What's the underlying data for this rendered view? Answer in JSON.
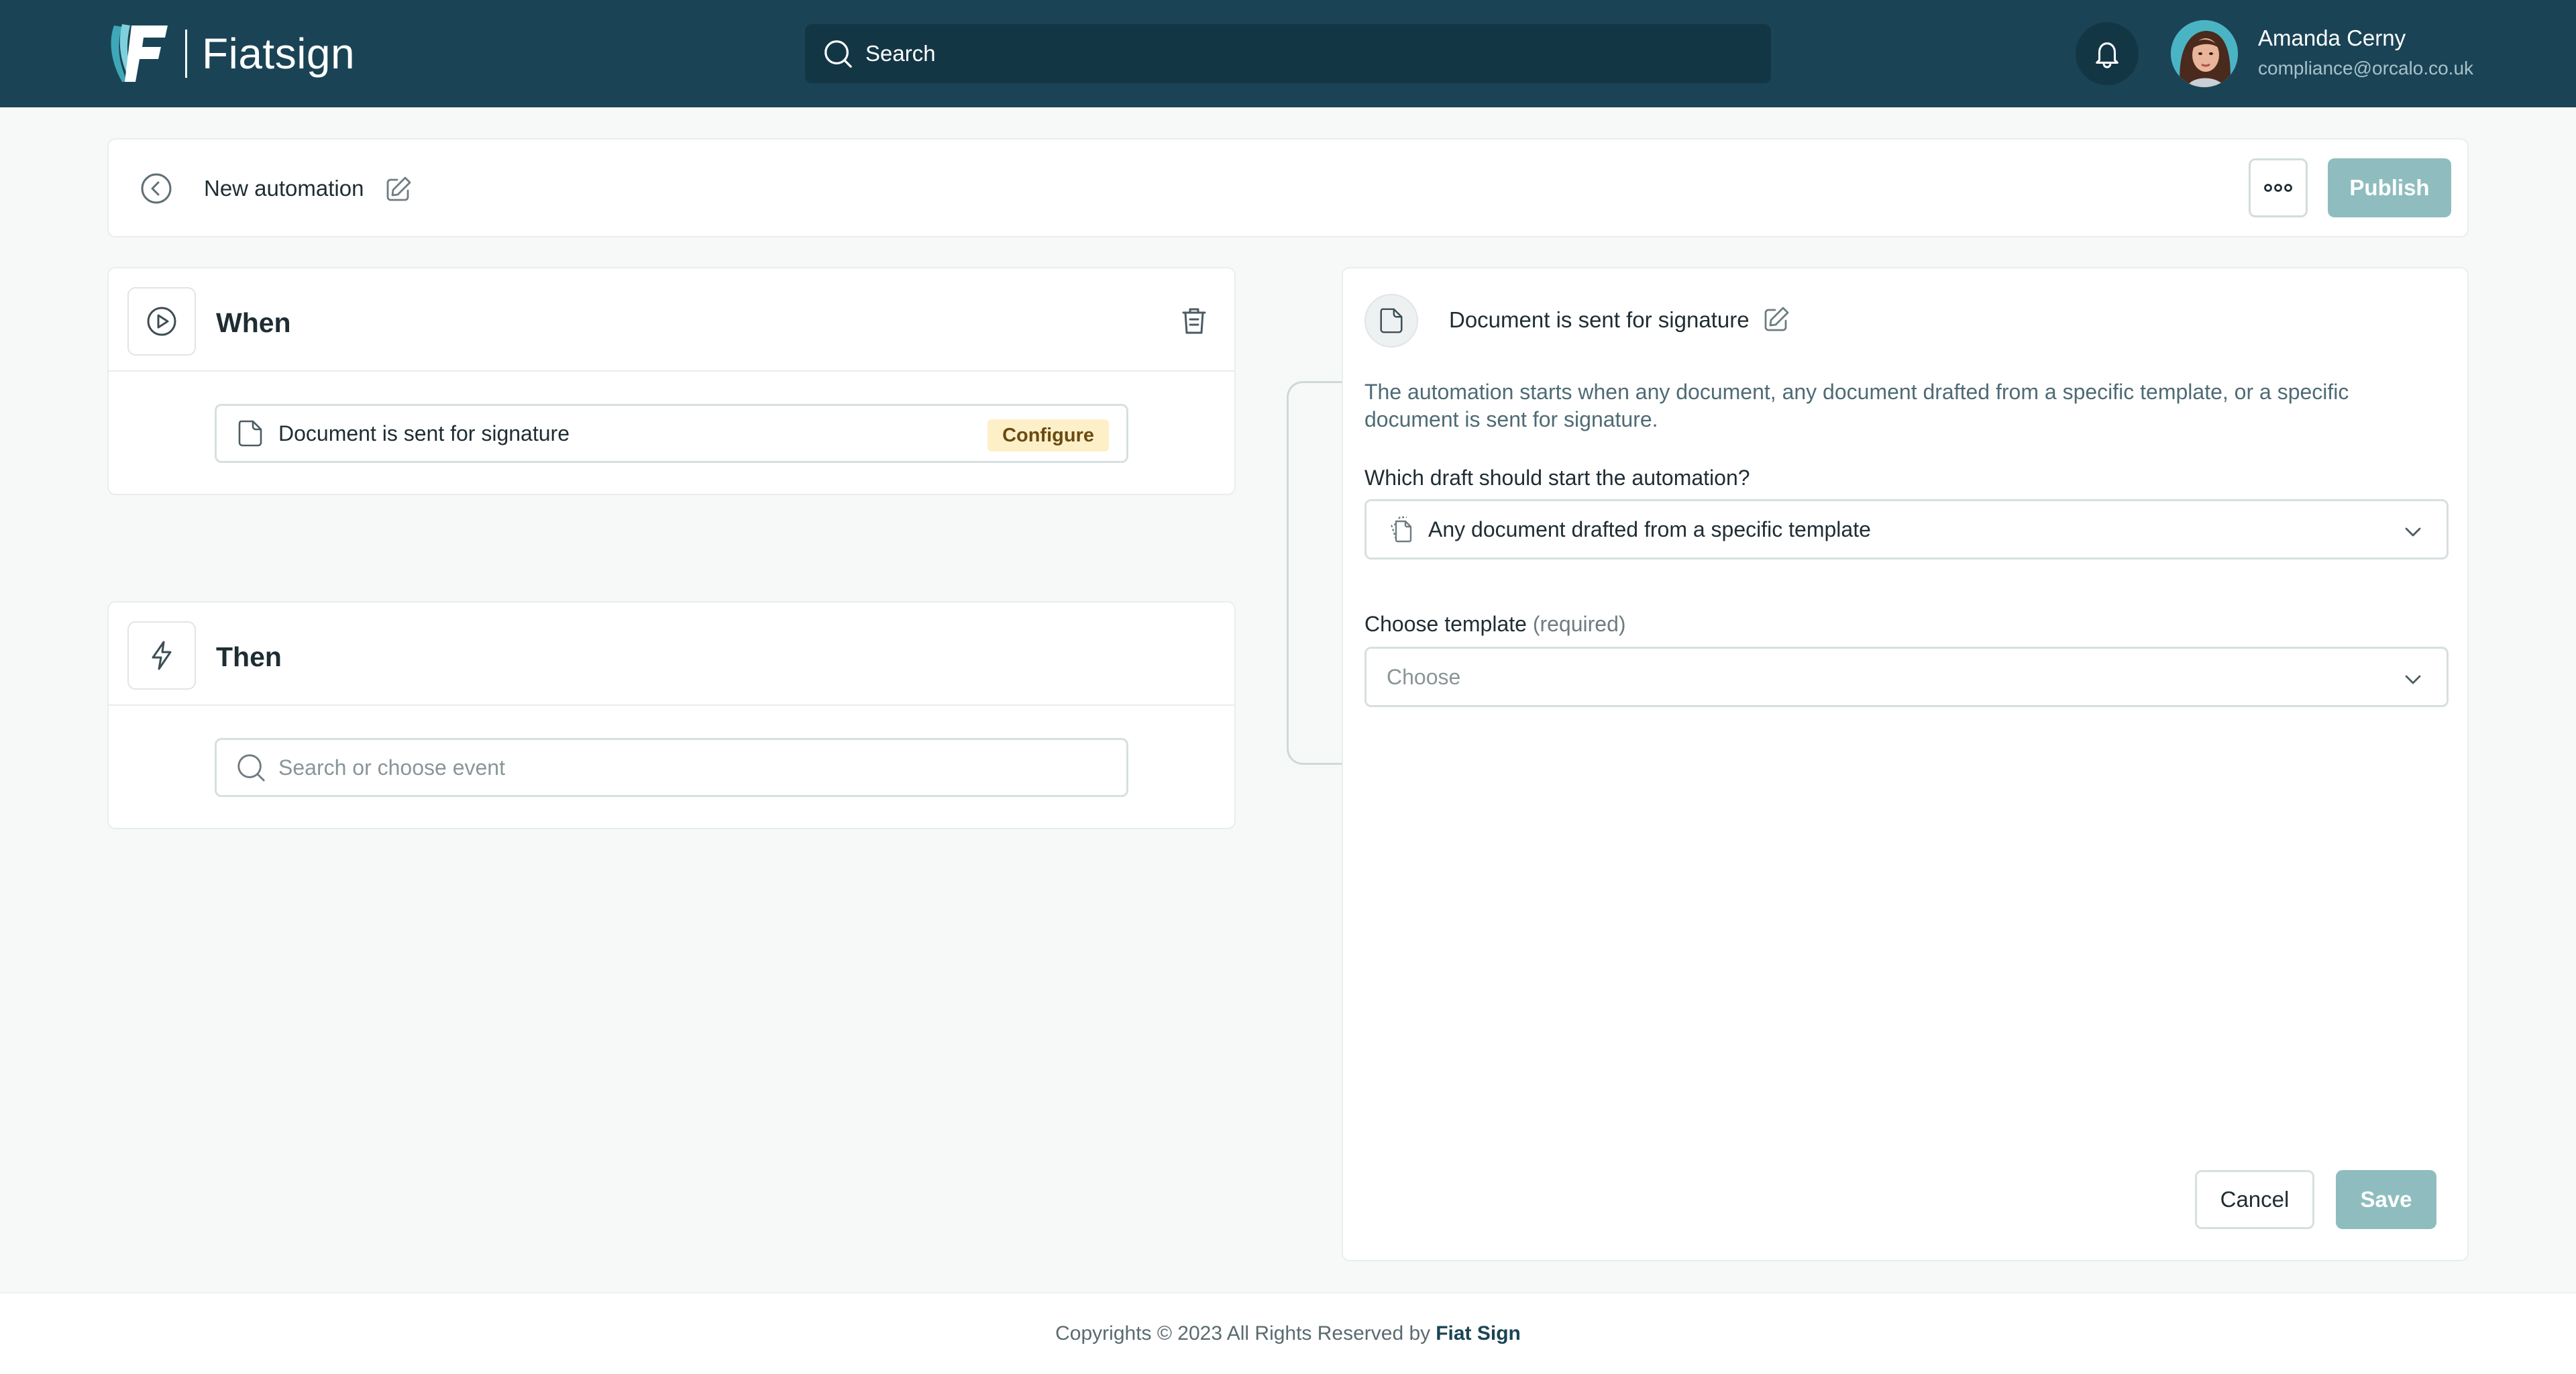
{
  "colors": {
    "header_bg": "#1a4455",
    "accent_teal": "#8fbdbf",
    "badge_bg": "#fdf0c8",
    "page_bg": "#f7f9f9"
  },
  "header": {
    "brand_name": "Fiatsign",
    "logo_icon": "fiatsign-logo",
    "search_placeholder": "Search",
    "notifications_icon": "bell-icon",
    "user": {
      "name": "Amanda Cerny",
      "email": "compliance@orcalo.co.uk"
    }
  },
  "automation_bar": {
    "title": "New automation",
    "back_icon": "back-arrow-icon",
    "edit_icon": "edit-icon",
    "more_icon": "more-dots-icon",
    "publish_label": "Publish"
  },
  "when_card": {
    "title": "When",
    "icon": "play-icon",
    "delete_icon": "trash-icon",
    "trigger": {
      "label": "Document is sent for signature",
      "badge": "Configure"
    }
  },
  "then_card": {
    "title": "Then",
    "icon": "lightning-icon",
    "event_placeholder": "Search or choose event"
  },
  "panel": {
    "title": "Document is sent for signature",
    "description": "The automation starts when any document, any document drafted from a specific template, or a specific document is sent for signature.",
    "draft_question": "Which draft should start the automation?",
    "draft_selected": "Any document drafted from a specific template",
    "template_label": "Choose template",
    "template_required": "(required)",
    "template_placeholder": "Choose",
    "cancel_label": "Cancel",
    "save_label": "Save"
  },
  "footer": {
    "text": "Copyrights © 2023 All Rights Reserved by",
    "brand": "Fiat Sign"
  }
}
